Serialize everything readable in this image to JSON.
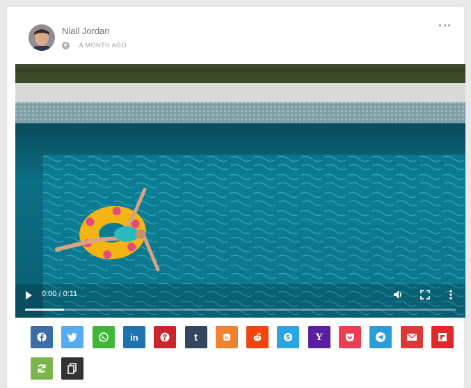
{
  "post": {
    "author": "Niall Jordan",
    "time": "A MONTH AGO",
    "menu_icon": "more-dots-icon"
  },
  "video": {
    "time_display": "0:00 / 0:11",
    "progress": 0.09,
    "icons": [
      "play-icon",
      "volume-icon",
      "fullscreen-icon",
      "more-vertical-icon"
    ]
  },
  "share": {
    "buttons": [
      {
        "name": "facebook",
        "icon": "facebook-icon",
        "color": "#3b6dab",
        "glyph": "f"
      },
      {
        "name": "twitter",
        "icon": "twitter-icon",
        "color": "#55acee",
        "glyph": "t"
      },
      {
        "name": "whatsapp",
        "icon": "whatsapp-icon",
        "color": "#3fb63a",
        "glyph": "w"
      },
      {
        "name": "linkedin",
        "icon": "linkedin-icon",
        "color": "#1f71b0",
        "glyph": "in"
      },
      {
        "name": "pinterest",
        "icon": "pinterest-icon",
        "color": "#c9252c",
        "glyph": "p"
      },
      {
        "name": "tumblr",
        "icon": "tumblr-icon",
        "color": "#34465d",
        "glyph": "t"
      },
      {
        "name": "blogger",
        "icon": "blogger-icon",
        "color": "#f1832e",
        "glyph": "b"
      },
      {
        "name": "reddit",
        "icon": "reddit-icon",
        "color": "#f0450f",
        "glyph": "r"
      },
      {
        "name": "skype",
        "icon": "skype-icon",
        "color": "#2aa5e2",
        "glyph": "s"
      },
      {
        "name": "yahoo",
        "icon": "yahoo-icon",
        "color": "#5a1fa0",
        "glyph": "Y"
      },
      {
        "name": "pocket",
        "icon": "pocket-icon",
        "color": "#ee3e55",
        "glyph": "pk"
      },
      {
        "name": "telegram",
        "icon": "telegram-icon",
        "color": "#2a9ed8",
        "glyph": "tg"
      },
      {
        "name": "email",
        "icon": "email-icon",
        "color": "#dd3939",
        "glyph": "m"
      },
      {
        "name": "flipboard",
        "icon": "flipboard-icon",
        "color": "#e12828",
        "glyph": "fb"
      },
      {
        "name": "refresh",
        "icon": "refresh-icon",
        "color": "#7ab649",
        "glyph": "rf"
      },
      {
        "name": "copy",
        "icon": "copy-icon",
        "color": "#333333",
        "glyph": "cp"
      }
    ]
  }
}
